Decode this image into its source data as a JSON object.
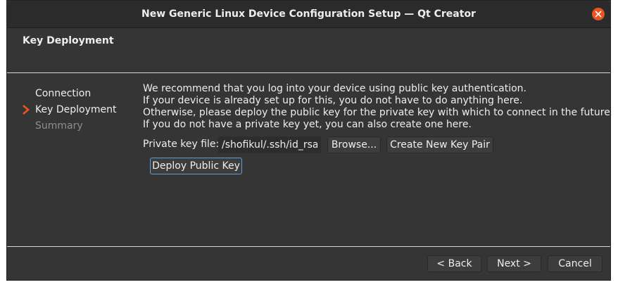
{
  "window": {
    "title": "New Generic Linux Device Configuration Setup — Qt Creator"
  },
  "page": {
    "title": "Key Deployment"
  },
  "steps": [
    {
      "label": "Connection",
      "state": "done"
    },
    {
      "label": "Key Deployment",
      "state": "current"
    },
    {
      "label": "Summary",
      "state": "pending"
    }
  ],
  "description": [
    "We recommend that you log into your device using public key authentication.",
    "If your device is already set up for this, you do not have to do anything here.",
    "Otherwise, please deploy the public key for the private key with which to connect in the future.",
    "If you do not have a private key yet, you can also create one here."
  ],
  "key": {
    "label": "Private key file:",
    "value": "/shofikul/.ssh/id_rsa",
    "browse_label": "Browse...",
    "create_label": "Create New Key Pair"
  },
  "deploy_label": "Deploy Public Key",
  "nav": {
    "back_label": "< Back",
    "next_label": "Next >",
    "cancel_label": "Cancel"
  },
  "colors": {
    "accent": "#e95420",
    "focus": "#5f9ad6"
  },
  "icons": {
    "close": "close-icon",
    "current_step": "chevron-right-icon"
  }
}
